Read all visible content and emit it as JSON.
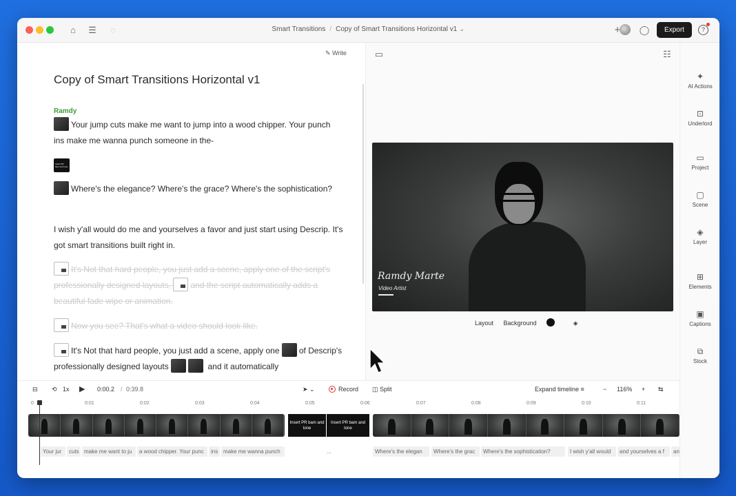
{
  "titlebar": {
    "project": "Smart Transitions",
    "separator": "/",
    "composition": "Copy of Smart Transitions Horizontal v1",
    "export_label": "Export",
    "help_label": "?"
  },
  "script": {
    "write_label": "Write",
    "title": "Copy of Smart Transitions Horizontal v1",
    "speaker": "Ramdy",
    "scene_card_label": "Insert PR bam and tone",
    "paragraphs": [
      "Your jump cuts make me want to jump into a wood chipper. Your punch ins make me wanna punch someone in the-",
      "Where's the elegance? Where's the grace? Where's the sophistication?",
      "I wish y'all would do me and yourselves a favor and just start using Descrip. It's got smart transitions built right in.",
      "It's Not that hard people, you just add a scene, apply one of the script's professionally designed layouts,",
      "and the script automatically adds a beautiful fade wipe or animation.",
      "Now you see? That's what a video should look like.",
      "It's Not that hard people, you just add a scene, apply one",
      "of",
      "Descrip's professionally designed layouts",
      "and it automatically"
    ]
  },
  "preview": {
    "lower_third_name": "Ramdy Marte",
    "lower_third_role": "Video Artist",
    "layout_label": "Layout",
    "background_label": "Background",
    "background_color": "#111111"
  },
  "rail": [
    {
      "icon": "sparkle-icon",
      "label": "AI Actions"
    },
    {
      "icon": "robot-icon",
      "label": "Underlord"
    },
    {
      "icon": "folder-icon",
      "label": "Project"
    },
    {
      "icon": "scene-icon",
      "label": "Scene"
    },
    {
      "icon": "layers-icon",
      "label": "Layer"
    },
    {
      "icon": "elements-icon",
      "label": "Elements"
    },
    {
      "icon": "captions-icon",
      "label": "Captions"
    },
    {
      "icon": "stock-icon",
      "label": "Stock"
    }
  ],
  "transport": {
    "speed": "1x",
    "current_time": "0:00.2",
    "time_sep": "/",
    "total_time": "0:39.8",
    "record_label": "Record",
    "split_label": "Split",
    "expand_label": "Expand timeline",
    "zoom": "116%"
  },
  "ruler": [
    "0:01",
    "0:02",
    "0:03",
    "0:04",
    "0:05",
    "0:06",
    "0:07",
    "0:08",
    "0:09",
    "0:10",
    "0:11"
  ],
  "timeline": {
    "title_clip_a": "Insert PR bam and tone",
    "title_clip_b": "Insert PR bam and tone",
    "captions": [
      "Your jur",
      "cuts",
      "make me want to ju",
      "a wood chipper. Your punc",
      "ins",
      "make me wanna punch",
      "...",
      "Where's the elegan",
      "Where's the grac",
      "Where's the sophistication?",
      "I wish y'all would",
      "and yourselves a f",
      "an"
    ]
  },
  "colors": {
    "accent_green": "#3e9b3e",
    "record_red": "#d63a3a",
    "export_bg": "#1b1b1b"
  }
}
